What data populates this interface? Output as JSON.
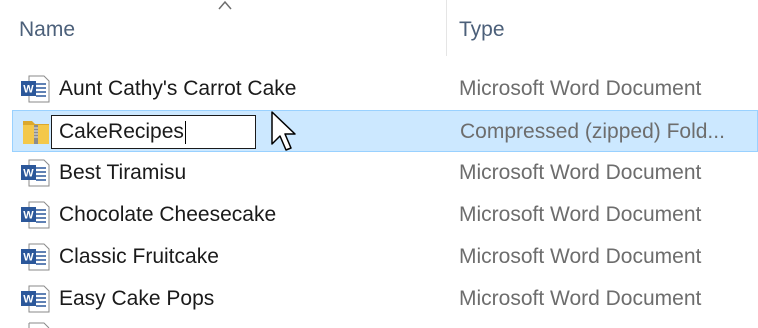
{
  "header": {
    "name_label": "Name",
    "type_label": "Type",
    "sort_indicator": "sort-ascending-icon"
  },
  "files": [
    {
      "name": "Aunt Cathy's Carrot Cake",
      "type": "Microsoft Word Document",
      "icon": "word-document-icon",
      "selected": false
    },
    {
      "name": "CakeRecipes",
      "type": "Compressed (zipped) Fold...",
      "icon": "zip-folder-icon",
      "selected": true,
      "renaming": true
    },
    {
      "name": "Best Tiramisu",
      "type": "Microsoft Word Document",
      "icon": "word-document-icon",
      "selected": false
    },
    {
      "name": "Chocolate Cheesecake",
      "type": "Microsoft Word Document",
      "icon": "word-document-icon",
      "selected": false
    },
    {
      "name": "Classic Fruitcake",
      "type": "Microsoft Word Document",
      "icon": "word-document-icon",
      "selected": false
    },
    {
      "name": "Easy Cake Pops",
      "type": "Microsoft Word Document",
      "icon": "word-document-icon",
      "selected": false
    }
  ],
  "colors": {
    "selection_bg": "#cce8ff",
    "selection_border": "#99d1ff",
    "header_text": "#4c607a",
    "word_blue": "#2b579a",
    "zip_yellow": "#f4c84a"
  }
}
